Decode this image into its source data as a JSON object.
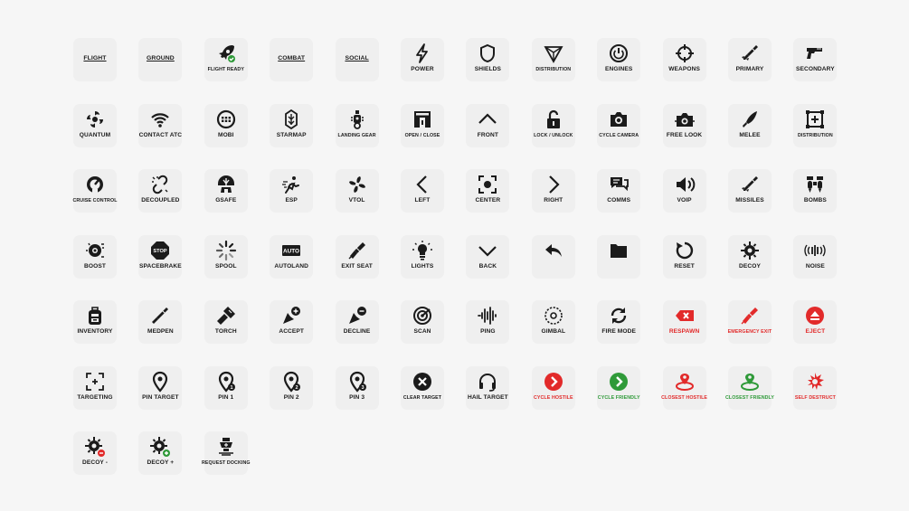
{
  "colors": {
    "background": "#f6f6f6",
    "tile": "#efefef",
    "text": "#1b1b1b",
    "hostile": "#e22a2a",
    "friendly": "#2f9a39"
  },
  "tiles": [
    {
      "label": "FLIGHT",
      "icon": "none"
    },
    {
      "label": "GROUND",
      "icon": "none"
    },
    {
      "label": "FLIGHT READY",
      "icon": "rocket-check-icon"
    },
    {
      "label": "COMBAT",
      "icon": "none"
    },
    {
      "label": "SOCIAL",
      "icon": "none"
    },
    {
      "label": "POWER",
      "icon": "lightning-icon"
    },
    {
      "label": "SHIELDS",
      "icon": "shield-icon"
    },
    {
      "label": "DISTRIBUTION",
      "icon": "distribution-triangle-icon"
    },
    {
      "label": "ENGINES",
      "icon": "power-circle-icon"
    },
    {
      "label": "WEAPONS",
      "icon": "crosshair-icon"
    },
    {
      "label": "PRIMARY",
      "icon": "missile-icon"
    },
    {
      "label": "SECONDARY",
      "icon": "gun-icon"
    },
    {
      "label": "QUANTUM",
      "icon": "quantum-swirl-icon"
    },
    {
      "label": "CONTACT ATC",
      "icon": "wifi-icon"
    },
    {
      "label": "MOBI",
      "icon": "mobi-icon"
    },
    {
      "label": "STARMAP",
      "icon": "starmap-icon"
    },
    {
      "label": "LANDING GEAR",
      "icon": "landing-gear-icon"
    },
    {
      "label": "OPEN / CLOSE",
      "icon": "door-icon"
    },
    {
      "label": "FRONT",
      "icon": "chevron-up-icon"
    },
    {
      "label": "LOCK / UNLOCK",
      "icon": "padlock-open-icon"
    },
    {
      "label": "CYCLE CAMERA",
      "icon": "camera-icon"
    },
    {
      "label": "FREE LOOK",
      "icon": "free-look-icon"
    },
    {
      "label": "MELEE",
      "icon": "knife-icon"
    },
    {
      "label": "DISTRIBUTION",
      "icon": "distribution-frame-icon"
    },
    {
      "label": "CRUISE CONTROL",
      "icon": "speedometer-icon"
    },
    {
      "label": "DECOUPLED",
      "icon": "broken-link-icon"
    },
    {
      "label": "GSAFE",
      "icon": "gsafe-icon"
    },
    {
      "label": "ESP",
      "icon": "esp-icon"
    },
    {
      "label": "VTOL",
      "icon": "fan-icon"
    },
    {
      "label": "LEFT",
      "icon": "chevron-left-icon"
    },
    {
      "label": "CENTER",
      "icon": "center-focus-icon"
    },
    {
      "label": "RIGHT",
      "icon": "chevron-right-icon"
    },
    {
      "label": "COMMS",
      "icon": "chat-bubbles-icon"
    },
    {
      "label": "VOIP",
      "icon": "speaker-icon"
    },
    {
      "label": "MISSILES",
      "icon": "missile-icon"
    },
    {
      "label": "BOMBS",
      "icon": "bombs-icon"
    },
    {
      "label": "BOOST",
      "icon": "boost-icon"
    },
    {
      "label": "SPACEBRAKE",
      "icon": "stop-sign-icon"
    },
    {
      "label": "SPOOL",
      "icon": "spool-loader-icon"
    },
    {
      "label": "AUTOLAND",
      "icon": "auto-badge-icon"
    },
    {
      "label": "EXIT SEAT",
      "icon": "exit-seat-icon"
    },
    {
      "label": "LIGHTS",
      "icon": "lightbulb-icon"
    },
    {
      "label": "BACK",
      "icon": "chevron-down-icon"
    },
    {
      "label": "",
      "icon": "reply-arrow-icon"
    },
    {
      "label": "",
      "icon": "folder-icon"
    },
    {
      "label": "RESET",
      "icon": "reset-icon"
    },
    {
      "label": "DECOY",
      "icon": "decoy-icon"
    },
    {
      "label": "NOISE",
      "icon": "noise-icon"
    },
    {
      "label": "INVENTORY",
      "icon": "backpack-icon"
    },
    {
      "label": "MEDPEN",
      "icon": "medpen-icon"
    },
    {
      "label": "TORCH",
      "icon": "torch-icon"
    },
    {
      "label": "ACCEPT",
      "icon": "cursor-plus-icon"
    },
    {
      "label": "DECLINE",
      "icon": "cursor-minus-icon"
    },
    {
      "label": "SCAN",
      "icon": "radar-icon"
    },
    {
      "label": "PING",
      "icon": "ping-wave-icon"
    },
    {
      "label": "GIMBAL",
      "icon": "gimbal-icon"
    },
    {
      "label": "FIRE MODE",
      "icon": "cycle-arrows-icon"
    },
    {
      "label": "RESPAWN",
      "icon": "respawn-icon",
      "color": "red"
    },
    {
      "label": "EMERGENCY EXIT",
      "icon": "emergency-exit-icon",
      "color": "red"
    },
    {
      "label": "EJECT",
      "icon": "eject-icon",
      "color": "red"
    },
    {
      "label": "TARGETING",
      "icon": "targeting-frame-icon"
    },
    {
      "label": "PIN TARGET",
      "icon": "map-pin-icon"
    },
    {
      "label": "PIN 1",
      "icon": "map-pin-1-icon"
    },
    {
      "label": "PIN 2",
      "icon": "map-pin-2-icon"
    },
    {
      "label": "PIN 3",
      "icon": "map-pin-3-icon"
    },
    {
      "label": "CLEAR TARGET",
      "icon": "clear-target-icon"
    },
    {
      "label": "HAIL TARGET",
      "icon": "headset-icon"
    },
    {
      "label": "CYCLE HOSTILE",
      "icon": "cycle-hostile-icon",
      "color": "red"
    },
    {
      "label": "CYCLE FRIENDLY",
      "icon": "cycle-friendly-icon",
      "color": "green"
    },
    {
      "label": "CLOSEST HOSTILE",
      "icon": "closest-hostile-icon",
      "color": "red"
    },
    {
      "label": "CLOSEST FRIENDLY",
      "icon": "closest-friendly-icon",
      "color": "green"
    },
    {
      "label": "SELF DESTRUCT",
      "icon": "self-destruct-icon",
      "color": "red"
    },
    {
      "label": "DECOY -",
      "icon": "decoy-minus-icon"
    },
    {
      "label": "DECOY +",
      "icon": "decoy-plus-icon"
    },
    {
      "label": "REQUEST DOCKING",
      "icon": "request-docking-icon"
    }
  ]
}
